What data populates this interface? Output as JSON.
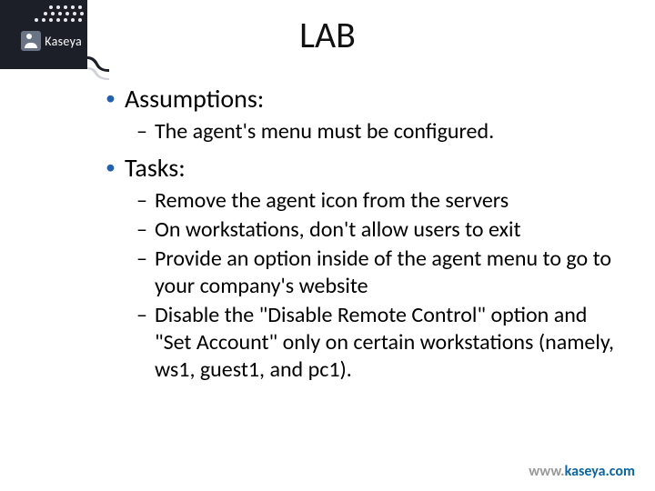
{
  "brand": {
    "name": "Kaseya"
  },
  "title": "LAB",
  "sections": [
    {
      "heading": "Assumptions:",
      "items": [
        "The agent's menu must be configured."
      ]
    },
    {
      "heading": "Tasks:",
      "items": [
        "Remove the agent icon from the servers",
        "On workstations, don't allow users to exit",
        "Provide an option inside of the agent menu to go to your company's website",
        "Disable the \"Disable Remote Control\" option and \"Set Account\" only on certain workstations (namely, ws1, guest1, and pc1)."
      ]
    }
  ],
  "footer": {
    "prefix": "www.",
    "domain": "kaseya.com"
  }
}
